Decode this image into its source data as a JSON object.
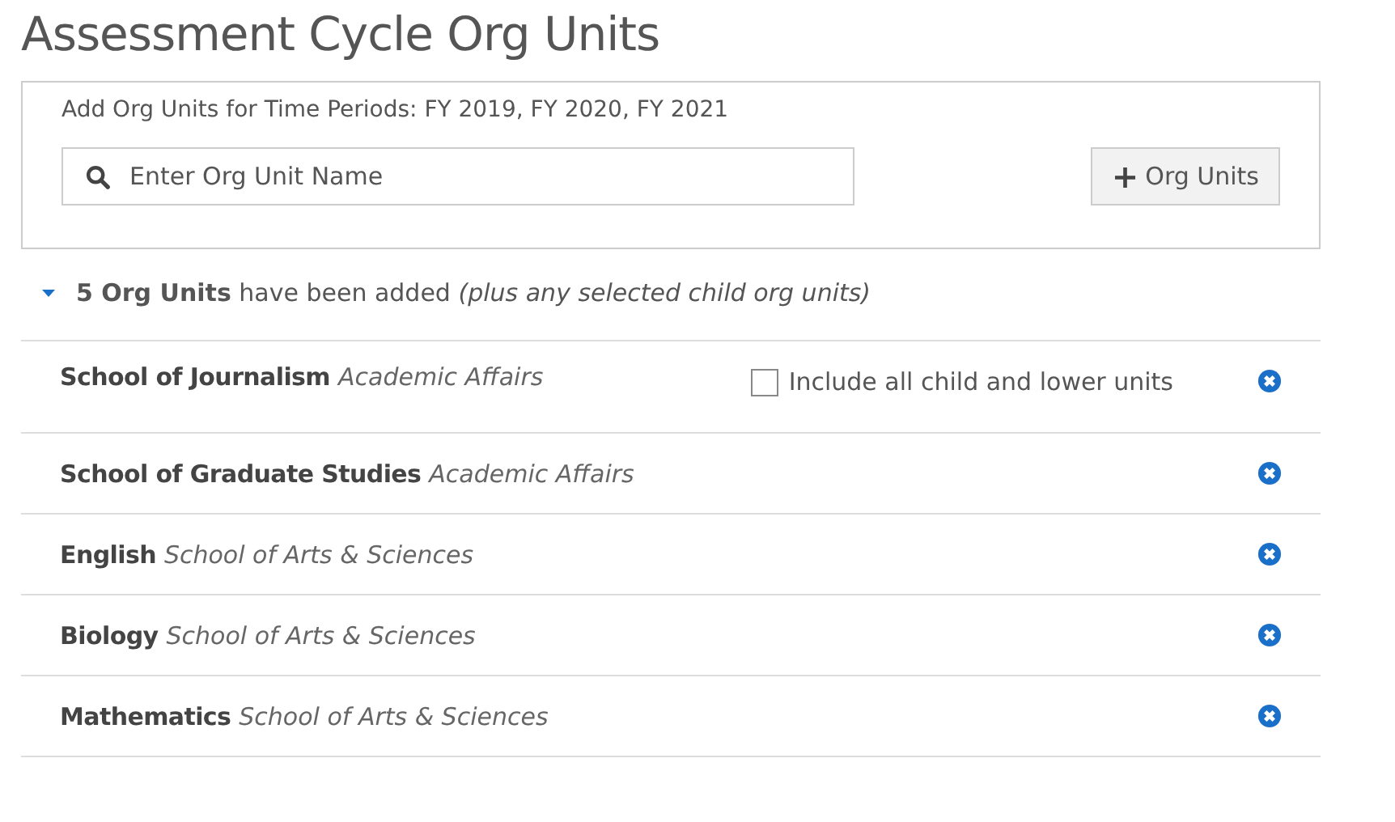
{
  "page_title": "Assessment Cycle Org Units",
  "add_panel": {
    "label": "Add Org Units for Time Periods: FY 2019, FY 2020, FY 2021",
    "search": {
      "placeholder": "Enter Org Unit Name"
    },
    "add_button": {
      "icon": "+",
      "label": "Org Units"
    }
  },
  "summary": {
    "expanded": true,
    "text": "**5 Org Units** have been added *(plus any selected child org units)*"
  },
  "org_units": [
    {
      "name": "School of Journalism",
      "parent": "Academic Affairs",
      "include_children": {
        "label": "Include all child and lower units",
        "checked": false
      }
    },
    {
      "name": "School of Graduate Studies",
      "parent": "Academic Affairs"
    },
    {
      "name": "English",
      "parent": "School of Arts & Sciences"
    },
    {
      "name": "Biology",
      "parent": "School of Arts & Sciences"
    },
    {
      "name": "Mathematics",
      "parent": "School of Arts & Sciences"
    }
  ]
}
